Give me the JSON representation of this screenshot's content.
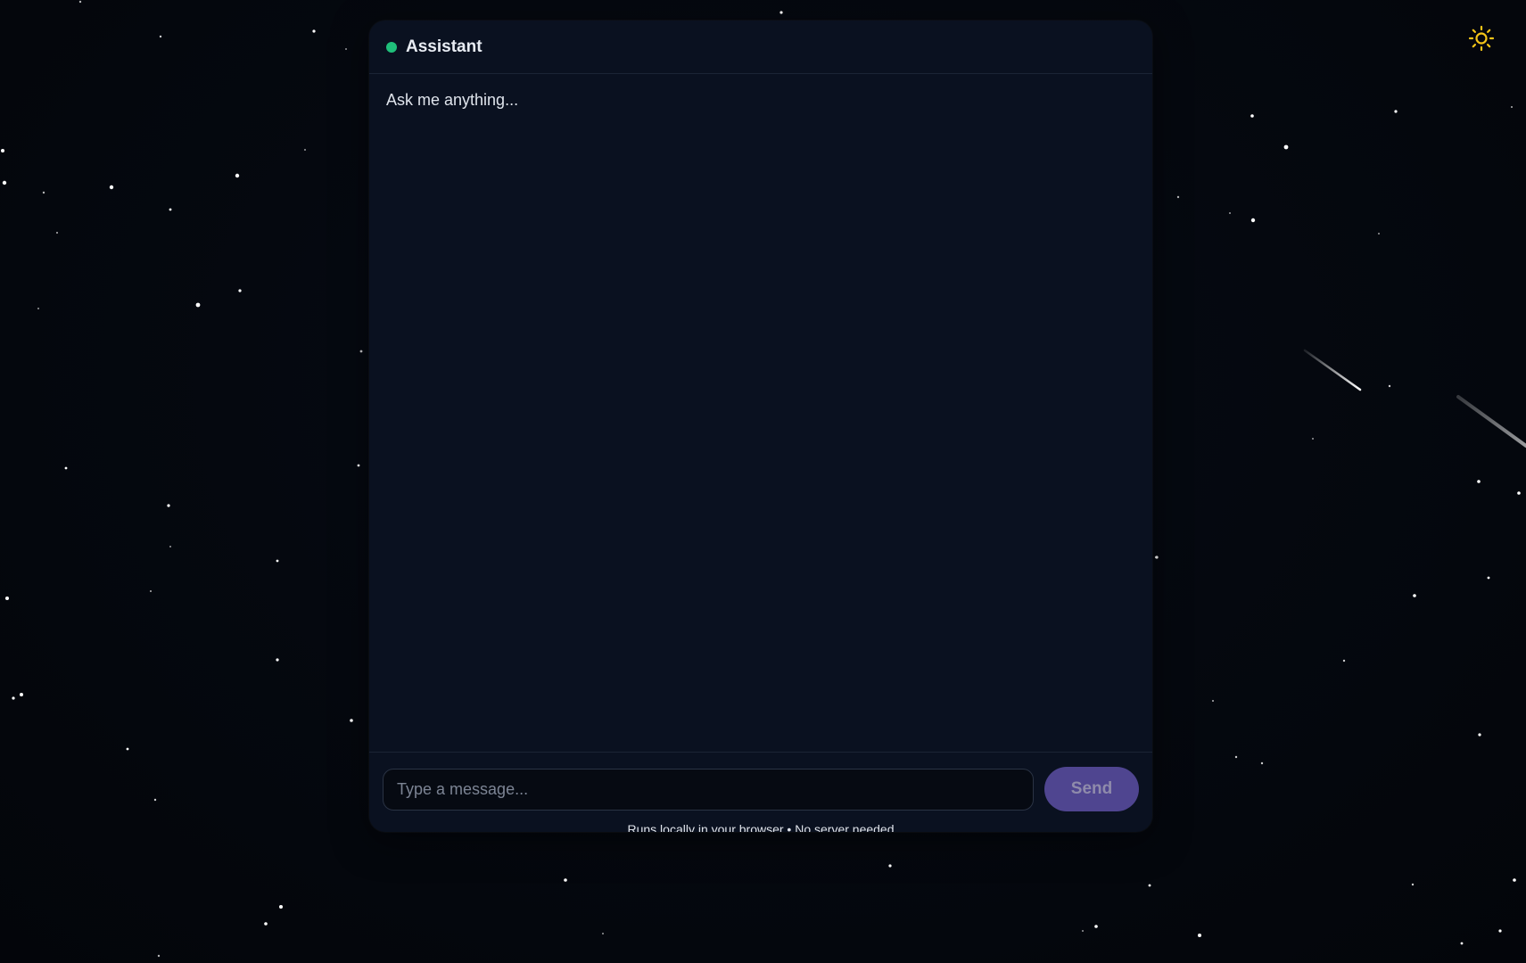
{
  "header": {
    "title": "Assistant",
    "status_color": "#1fbf7a"
  },
  "chat": {
    "greeting": "Ask me anything..."
  },
  "composer": {
    "placeholder": "Type a message...",
    "value": "",
    "send_label": "Send"
  },
  "footer": {
    "note": "Runs locally in your browser • No server needed"
  },
  "theme_toggle": {
    "icon": "sun-icon",
    "color": "#f5c518"
  },
  "colors": {
    "background": "#05080f",
    "panel": "#0a1120",
    "accent": "#4f4590"
  }
}
